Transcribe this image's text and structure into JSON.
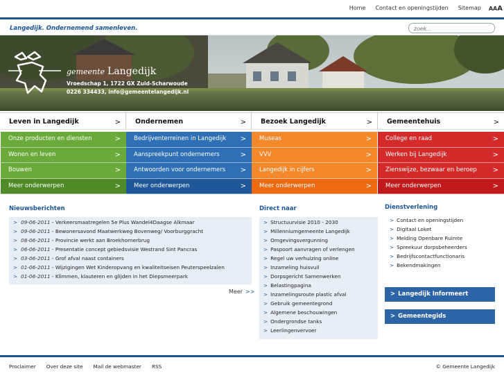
{
  "top_nav": {
    "home": "Home",
    "contact": "Contact en openingstijden",
    "sitemap": "Sitemap",
    "font_size_label": "AA",
    "font_size_big": "A"
  },
  "slogan": "Langedijk. Ondernemend samenleven.",
  "search": {
    "placeholder": "zoek..."
  },
  "hero": {
    "gem_prefix": "gemeente",
    "gem_name": "Langedijk",
    "address": "Vroedschap 1, 1722 GX Zuid-Scharwoude",
    "contact": "0226 334433, info@gemeentelangedijk.nl"
  },
  "columns": [
    {
      "title": "Leven in Langedijk",
      "color": "#6aaa3a",
      "items": [
        "Onze producten en diensten",
        "Wonen en leven",
        "Bouwen",
        "Meer onderwerpen"
      ]
    },
    {
      "title": "Ondernemen",
      "color": "#2f6fb6",
      "items": [
        "Bedrijventerreinen in Langedijk",
        "Aanspreekpunt ondernemers",
        "Antwoorden voor ondernemers",
        "Meer onderwerpen"
      ]
    },
    {
      "title": "Bezoek Langedijk",
      "color": "#f0781e",
      "items": [
        "Museas",
        "VVV",
        "Langedijk in cijfers",
        "Meer onderwerpen"
      ]
    },
    {
      "title": "Gemeentehuis",
      "color": "#d42a2a",
      "items": [
        "College en raad",
        "Werken bij Langedijk",
        "Zienswijze, bezwaar en beroep",
        "Meer onderwerpen"
      ]
    }
  ],
  "arrow": ">",
  "news": {
    "title": "Nieuwsberichten",
    "items": [
      {
        "date": "09-06-2011",
        "text": "Verkeersmaatregelen 5e Plus Wandel4Daagse Alkmaar"
      },
      {
        "date": "09-06-2011",
        "text": "Bewonersavond Maatwerkweg Bovenweg/ Voorburggracht"
      },
      {
        "date": "08-06-2011",
        "text": "Provincie werkt aan Broekhornerbrug"
      },
      {
        "date": "06-06-2011",
        "text": "Presentatie concept gebiedsvisie Westrand Sint Pancras"
      },
      {
        "date": "03-06-2011",
        "text": "Grof afval naast containers"
      },
      {
        "date": "01-06-2011",
        "text": "Wijzigingen Wet Kinderopvang en kwaliteitseisen Peuterspeelzalen"
      },
      {
        "date": "01-06-2011",
        "text": "Klimmen, klauteren en glijden in het Diepsmeerpark"
      }
    ],
    "more": "Meer",
    "more_arrow": ">>"
  },
  "direct": {
    "title": "Direct naar",
    "items": [
      "Structuurvisie 2010 - 2030",
      "Millenniumgemeente Langedijk",
      "Omgevingsvergunning",
      "Paspoort aanvragen of verlengen",
      "Regel uw verhuizing online",
      "Inzameling huisvuil",
      "Dorpsgericht Samenwerken",
      "Belastingpagina",
      "Inzamelingsroute plastic afval",
      "Gebruik gemeentegrond",
      "Algemene beschouwingen",
      "Ondergrondse tanks",
      "Leerlingenvervoer"
    ]
  },
  "dienst": {
    "title": "Dienstverlening",
    "items": [
      "Contact en openingstijden",
      "Digitaal Loket",
      "Melding Openbare Ruimte",
      "Spreekuur dorpsbeheerders",
      "Bedrijfscontactfunctionaris",
      "Bekendmakingen"
    ],
    "btn1": "Langedijk Informeert",
    "btn2": "Gemeentegids"
  },
  "footer": {
    "links": [
      "Proclaimer",
      "Over deze site",
      "Mail de webmaster",
      "RSS"
    ],
    "copyright": "© Gemeente Langedijk"
  }
}
